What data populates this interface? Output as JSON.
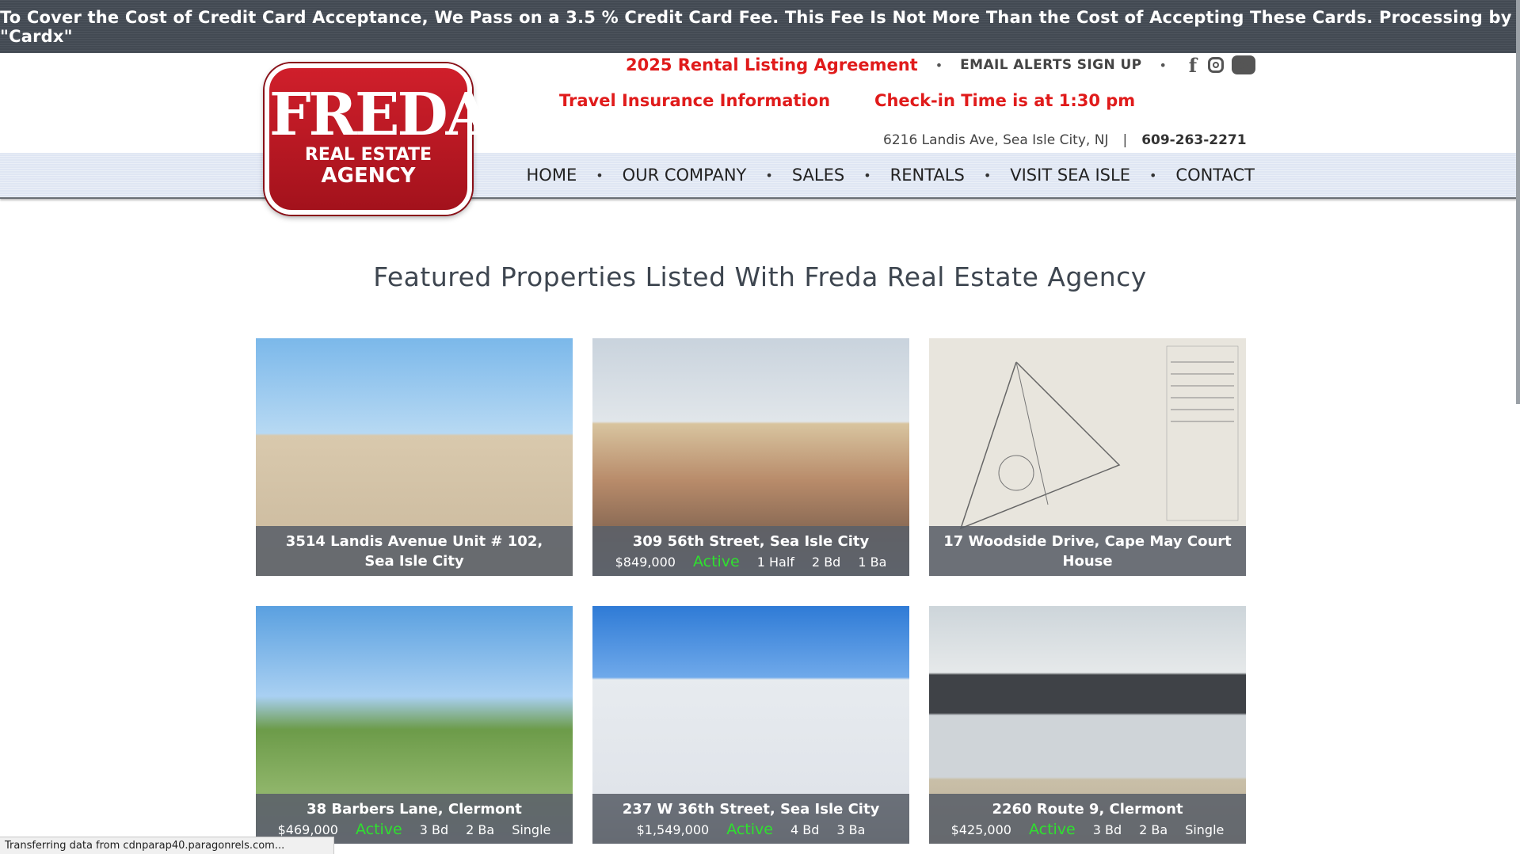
{
  "top_banner": "To Cover the Cost of Credit Card Acceptance, We Pass on a 3.5 % Credit Card Fee. This Fee Is Not More Than the Cost of Accepting These Cards. Processing by \"Cardx\"",
  "logo": {
    "line1": "FREDA",
    "line2": "REAL ESTATE",
    "line3": "AGENCY"
  },
  "header": {
    "rental_link": "2025 Rental Listing Agreement",
    "email_link": "EMAIL ALERTS SIGN UP",
    "travel_link": "Travel Insurance Information",
    "checkin_link": "Check-in Time is at 1:30 pm",
    "address": "6216 Landis Ave, Sea Isle City, NJ",
    "separator": "|",
    "phone": "609-263-2271",
    "social": {
      "facebook": "f"
    }
  },
  "nav": [
    "HOME",
    "OUR COMPANY",
    "SALES",
    "RENTALS",
    "VISIT SEA ISLE",
    "CONTACT"
  ],
  "nav_separator": "•",
  "heading": "Featured Properties Listed With Freda Real Estate Agency",
  "properties": [
    {
      "address": "3514 Landis Avenue Unit # 102, Sea Isle City"
    },
    {
      "address": "309 56th Street, Sea Isle City",
      "price": "$849,000",
      "status": "Active",
      "beds": "1 Half",
      "baths": "2 Bd",
      "type": "1 Ba"
    },
    {
      "address": "17 Woodside Drive, Cape May Court House"
    },
    {
      "address": "38 Barbers Lane, Clermont",
      "price": "$469,000",
      "status": "Active",
      "beds": "3 Bd",
      "baths": "2 Ba",
      "type": "Single"
    },
    {
      "address": "237 W 36th Street, Sea Isle City",
      "price": "$1,549,000",
      "status": "Active",
      "beds": "4 Bd",
      "baths": "3 Ba",
      "type": ""
    },
    {
      "address": "2260 Route 9, Clermont",
      "price": "$425,000",
      "status": "Active",
      "beds": "3 Bd",
      "baths": "2 Ba",
      "type": "Single"
    }
  ],
  "status_bar": "Transferring data from cdnparap40.paragonrels.com..."
}
